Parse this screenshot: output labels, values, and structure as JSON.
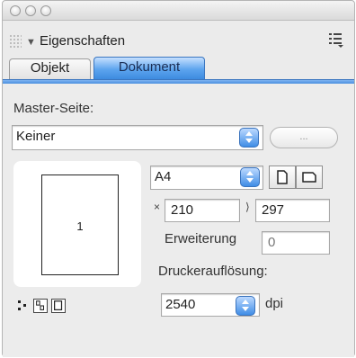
{
  "header": {
    "title": "Eigenschaften"
  },
  "tabs": {
    "objekt": "Objekt",
    "dokument": "Dokument"
  },
  "master": {
    "label": "Master-Seite:",
    "value": "Keiner",
    "browse_button": "..."
  },
  "preview": {
    "page_number": "1"
  },
  "page_setup": {
    "size": "A4",
    "x_marker": "×",
    "y_marker": "⟩",
    "width": "210",
    "height": "297",
    "extension_label": "Erweiterung",
    "extension_value": "0",
    "resolution_label": "Druckerauflösung:",
    "resolution_value": "2540",
    "resolution_unit": "dpi"
  },
  "colors": {
    "accent": "#4a90e0",
    "panel": "#ebebeb"
  }
}
